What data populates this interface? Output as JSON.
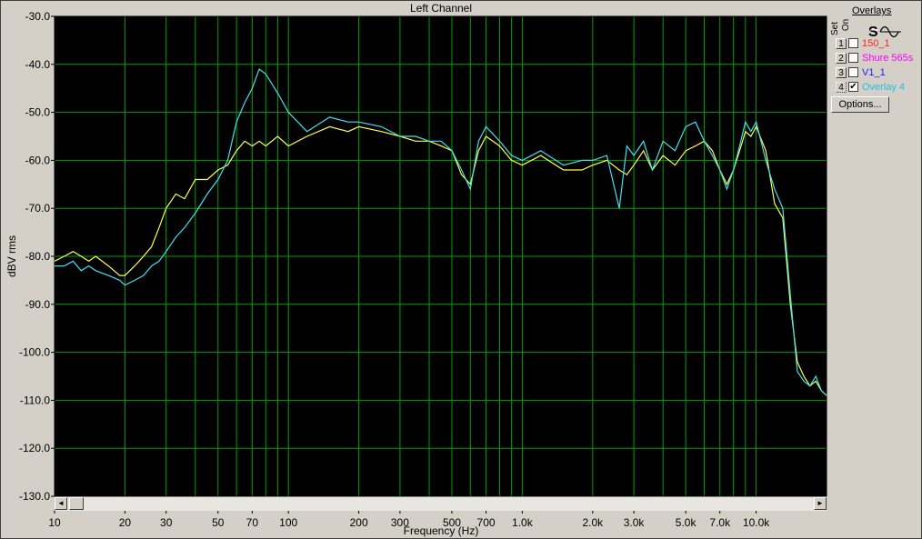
{
  "chart_data": {
    "type": "line",
    "title": "Left Channel",
    "xlabel": "Frequency (Hz)",
    "ylabel": "dBV rms",
    "xscale": "log",
    "xlim": [
      10,
      20000
    ],
    "ylim": [
      -130,
      -30
    ],
    "grid": true,
    "background": "#000000",
    "grid_color": "#00a000",
    "y_ticks": [
      -30,
      -40,
      -50,
      -60,
      -70,
      -80,
      -90,
      -100,
      -110,
      -120,
      -130
    ],
    "y_tick_labels": [
      "-30.0",
      "-40.0",
      "-50.0",
      "-60.0",
      "-70.0",
      "-80.0",
      "-90.0",
      "-100.0",
      "-110.0",
      "-120.0",
      "-130.0"
    ],
    "x_ticks": [
      10,
      20,
      30,
      50,
      70,
      100,
      200,
      300,
      500,
      700,
      1000,
      2000,
      3000,
      5000,
      7000,
      10000
    ],
    "x_tick_labels": [
      "10",
      "20",
      "30",
      "50",
      "70",
      "100",
      "200",
      "300",
      "500",
      "700",
      "1.0k",
      "2.0k",
      "3.0k",
      "5.0k",
      "7.0k",
      "10.0k"
    ],
    "series": [
      {
        "color": "#ffff40",
        "x": [
          10,
          11,
          12,
          13,
          14,
          15,
          17,
          19,
          20,
          22,
          24,
          26,
          28,
          30,
          33,
          36,
          40,
          45,
          50,
          55,
          60,
          65,
          70,
          75,
          80,
          90,
          100,
          120,
          150,
          180,
          200,
          250,
          300,
          350,
          400,
          450,
          500,
          550,
          600,
          650,
          700,
          800,
          900,
          1000,
          1200,
          1500,
          1800,
          2000,
          2300,
          2600,
          2800,
          3000,
          3300,
          3600,
          4000,
          4500,
          5000,
          5500,
          6000,
          6500,
          7000,
          7500,
          8000,
          8500,
          9000,
          9500,
          10000,
          11000,
          12000,
          13000,
          14000,
          15000,
          16000,
          17000,
          18000,
          19000,
          20000
        ],
        "y": [
          -81,
          -80,
          -79,
          -80,
          -81,
          -80,
          -82,
          -84,
          -84,
          -82,
          -80,
          -78,
          -74,
          -70,
          -67,
          -68,
          -64,
          -64,
          -62,
          -61,
          -58,
          -56,
          -57,
          -56,
          -57,
          -55,
          -57,
          -55,
          -53,
          -54,
          -53,
          -54,
          -55,
          -56,
          -56,
          -57,
          -58,
          -63,
          -65,
          -58,
          -55,
          -57,
          -60,
          -61,
          -59,
          -62,
          -62,
          -61,
          -60,
          -62,
          -63,
          -61,
          -58,
          -62,
          -59,
          -61,
          -58,
          -57,
          -56,
          -58,
          -62,
          -65,
          -62,
          -58,
          -54,
          -55,
          -53,
          -58,
          -69,
          -72,
          -90,
          -102,
          -105,
          -107,
          -106,
          -108,
          -109
        ]
      },
      {
        "color": "#40e0f0",
        "x": [
          10,
          11,
          12,
          13,
          14,
          15,
          17,
          19,
          20,
          22,
          24,
          26,
          28,
          30,
          33,
          36,
          40,
          45,
          50,
          55,
          60,
          65,
          70,
          75,
          80,
          90,
          100,
          120,
          150,
          180,
          200,
          250,
          300,
          350,
          400,
          450,
          500,
          550,
          600,
          650,
          700,
          800,
          900,
          1000,
          1200,
          1500,
          1800,
          2000,
          2300,
          2600,
          2800,
          3000,
          3300,
          3600,
          4000,
          4500,
          5000,
          5500,
          6000,
          6500,
          7000,
          7500,
          8000,
          8500,
          9000,
          9500,
          10000,
          11000,
          12000,
          13000,
          14000,
          15000,
          16000,
          17000,
          18000,
          19000,
          20000
        ],
        "y": [
          -82,
          -82,
          -81,
          -83,
          -82,
          -83,
          -84,
          -85,
          -86,
          -85,
          -84,
          -82,
          -81,
          -79,
          -76,
          -74,
          -71,
          -67,
          -64,
          -60,
          -52,
          -48,
          -45,
          -41,
          -42,
          -46,
          -50,
          -54,
          -51,
          -52,
          -52,
          -53,
          -55,
          -55,
          -56,
          -56,
          -58,
          -62,
          -66,
          -56,
          -53,
          -56,
          -59,
          -60,
          -58,
          -61,
          -60,
          -60,
          -59,
          -70,
          -57,
          -59,
          -56,
          -62,
          -56,
          -58,
          -53,
          -52,
          -56,
          -59,
          -62,
          -66,
          -62,
          -57,
          -52,
          -54,
          -52,
          -60,
          -66,
          -70,
          -88,
          -104,
          -106,
          -107,
          -105,
          -108,
          -109
        ]
      }
    ]
  },
  "scrollbar": {
    "left_arrow": "◄",
    "right_arrow": "►"
  },
  "overlays": {
    "title": "Overlays",
    "set_label": "Set",
    "on_label": "On",
    "items": [
      {
        "num": "1",
        "name": "150_1",
        "color": "#ff2020",
        "checked": false
      },
      {
        "num": "2",
        "name": "Shure 565s",
        "color": "#ff00ff",
        "checked": false
      },
      {
        "num": "3",
        "name": "V1_1",
        "color": "#2020ff",
        "checked": false
      },
      {
        "num": "4",
        "name": "Overlay 4",
        "color": "#20c0e0",
        "checked": true
      }
    ],
    "options_label": "Options..."
  },
  "icons": {
    "set_icon": "set-icon",
    "wave_icon": "wave-icon"
  }
}
